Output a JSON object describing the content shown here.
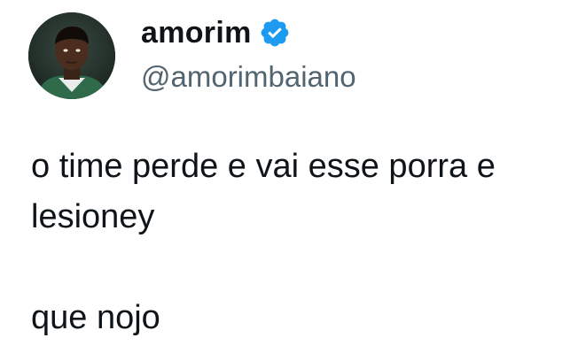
{
  "author": {
    "display_name": "amorim",
    "handle": "@amorimbaiano",
    "verified": true,
    "verified_color": "#1d9bf0"
  },
  "tweet": {
    "text": "o time perde e vai esse porra e\nlesioney\n\nque nojo"
  },
  "icons": {
    "verified": "verified-badge-icon",
    "avatar": "profile-photo"
  }
}
